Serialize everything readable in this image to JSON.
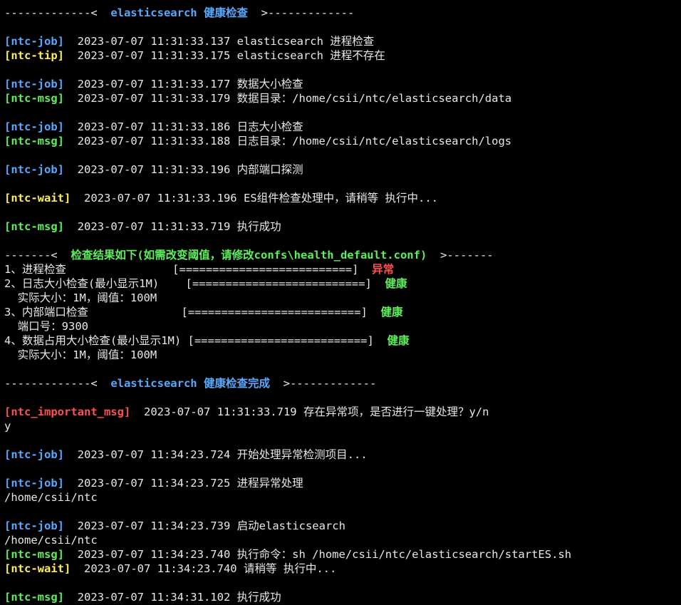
{
  "colors": {
    "background": "#000000",
    "text": "#e8e8e8",
    "job": "#56a9ff",
    "tip": "#ffee55",
    "msg": "#5cf05c",
    "important": "#ff5050"
  },
  "terminal": {
    "lines": [
      {
        "kind": "banner",
        "prefix": "-------------<  ",
        "title": "elasticsearch 健康检查",
        "suffix": "  >-------------",
        "color": "blue"
      },
      {
        "kind": "blank"
      },
      {
        "kind": "log",
        "tag": "[ntc-job]",
        "color": "blue",
        "time": "2023-07-07 11:31:33.137",
        "message": "elasticsearch 进程检查"
      },
      {
        "kind": "log",
        "tag": "[ntc-tip]",
        "color": "yellow",
        "time": "2023-07-07 11:31:33.175",
        "message": "elasticsearch 进程不存在"
      },
      {
        "kind": "blank"
      },
      {
        "kind": "log",
        "tag": "[ntc-job]",
        "color": "blue",
        "time": "2023-07-07 11:31:33.177",
        "message": "数据大小检查"
      },
      {
        "kind": "log",
        "tag": "[ntc-msg]",
        "color": "green",
        "time": "2023-07-07 11:31:33.179",
        "message": "数据目录：/home/csii/ntc/elasticsearch/data"
      },
      {
        "kind": "blank"
      },
      {
        "kind": "log",
        "tag": "[ntc-job]",
        "color": "blue",
        "time": "2023-07-07 11:31:33.186",
        "message": "日志大小检查"
      },
      {
        "kind": "log",
        "tag": "[ntc-msg]",
        "color": "green",
        "time": "2023-07-07 11:31:33.188",
        "message": "日志目录：/home/csii/ntc/elasticsearch/logs"
      },
      {
        "kind": "blank"
      },
      {
        "kind": "log",
        "tag": "[ntc-job]",
        "color": "blue",
        "time": "2023-07-07 11:31:33.196",
        "message": "内部端口探测"
      },
      {
        "kind": "blank"
      },
      {
        "kind": "log",
        "tag": "[ntc-wait]",
        "color": "yellow",
        "time": "2023-07-07 11:31:33.196",
        "message": "ES组件检查处理中，请稍等 执行中..."
      },
      {
        "kind": "blank"
      },
      {
        "kind": "log",
        "tag": "[ntc-msg]",
        "color": "green",
        "time": "2023-07-07 11:31:33.719",
        "message": "执行成功"
      },
      {
        "kind": "blank"
      },
      {
        "kind": "banner",
        "prefix": "-------<  ",
        "title": "检查结果如下(如需改变阈值，请修改confs\\health_default.conf)",
        "suffix": "  >-------",
        "color": "green"
      },
      {
        "kind": "result",
        "label": "1、进程检查                ",
        "bar": "[==========================]",
        "status": "异常",
        "color": "red"
      },
      {
        "kind": "result",
        "label": "2、日志大小检查(最小显示1M)    ",
        "bar": "[==========================]",
        "status": "健康",
        "color": "green"
      },
      {
        "kind": "plain",
        "text": "  实际大小：1M，阈值：100M"
      },
      {
        "kind": "result",
        "label": "3、内部端口检查              ",
        "bar": "[==========================]",
        "status": "健康",
        "color": "green"
      },
      {
        "kind": "plain",
        "text": "  端口号：9300"
      },
      {
        "kind": "result",
        "label": "4、数据占用大小检查(最小显示1M) ",
        "bar": "[==========================]",
        "status": "健康",
        "color": "green"
      },
      {
        "kind": "plain",
        "text": "  实际大小：1M，阈值：100M"
      },
      {
        "kind": "blank"
      },
      {
        "kind": "banner",
        "prefix": "-------------<  ",
        "title": "elasticsearch 健康检查完成",
        "suffix": "  >-------------",
        "color": "blue"
      },
      {
        "kind": "blank"
      },
      {
        "kind": "log",
        "tag": "[ntc_important_msg]",
        "color": "red",
        "time": "2023-07-07 11:31:33.719",
        "message": "存在异常项，是否进行一键处理？y/n"
      },
      {
        "kind": "plain",
        "text": "y"
      },
      {
        "kind": "blank"
      },
      {
        "kind": "log",
        "tag": "[ntc-job]",
        "color": "blue",
        "time": "2023-07-07 11:34:23.724",
        "message": "开始处理异常检测项目..."
      },
      {
        "kind": "blank"
      },
      {
        "kind": "log",
        "tag": "[ntc-job]",
        "color": "blue",
        "time": "2023-07-07 11:34:23.725",
        "message": "进程异常处理"
      },
      {
        "kind": "plain",
        "text": "/home/csii/ntc"
      },
      {
        "kind": "blank"
      },
      {
        "kind": "log",
        "tag": "[ntc-job]",
        "color": "blue",
        "time": "2023-07-07 11:34:23.739",
        "message": "启动elasticsearch"
      },
      {
        "kind": "plain",
        "text": "/home/csii/ntc"
      },
      {
        "kind": "log",
        "tag": "[ntc-msg]",
        "color": "green",
        "time": "2023-07-07 11:34:23.740",
        "message": "执行命令：sh /home/csii/ntc/elasticsearch/startES.sh"
      },
      {
        "kind": "log",
        "tag": "[ntc-wait]",
        "color": "yellow",
        "time": "2023-07-07 11:34:23.740",
        "message": "请稍等 执行中..."
      },
      {
        "kind": "blank"
      },
      {
        "kind": "log",
        "tag": "[ntc-msg]",
        "color": "green",
        "time": "2023-07-07 11:34:31.102",
        "message": "执行成功"
      }
    ]
  }
}
